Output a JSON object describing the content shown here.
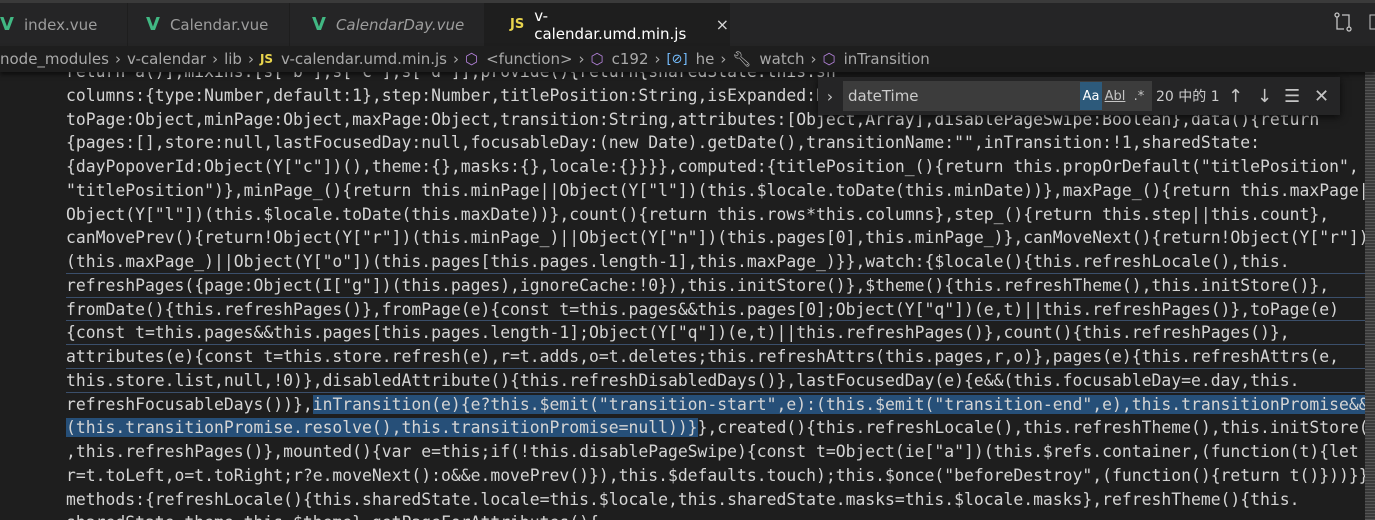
{
  "tabs": [
    {
      "label": "index.vue",
      "icon": "vue-icon"
    },
    {
      "label": "Calendar.vue",
      "icon": "vue-icon"
    },
    {
      "label": "CalendarDay.vue",
      "icon": "vue-icon"
    },
    {
      "label": "v-calendar.umd.min.js",
      "icon": "js-icon"
    }
  ],
  "tab_icon_text": {
    "vue": "V",
    "js": "JS",
    "close": "×"
  },
  "breadcrumb": [
    "node_modules",
    "v-calendar",
    "lib",
    "v-calendar.umd.min.js",
    "<function>",
    "c192",
    "he",
    "watch",
    "inTransition"
  ],
  "find": {
    "value": "dateTime",
    "match_case": "Aa",
    "whole_word": "Abl",
    "regex": ".*",
    "count": "20 中的 1",
    "expand": "›"
  },
  "code_lines": [
    {
      "text": "return a()],mixins:[s[\"b\"],s[\"c\"],s[\"d\"]],provide(){return{sharedState:this.sh"
    },
    {
      "text": "columns:{type:Number,default:1},step:Number,titlePosition:String,isExpanded:Bo"
    },
    {
      "text": "toPage:Object,minPage:Object,maxPage:Object,transition:String,attributes:[Object,Array],disablePageSwipe:Boolean},data(){return"
    },
    {
      "text": "{pages:[],store:null,lastFocusedDay:null,focusableDay:(new Date).getDate(),transitionName:\"\",inTransition:!1,sharedState:"
    },
    {
      "text": "{dayPopoverId:Object(Y[\"c\"])(),theme:{},masks:{},locale:{}}}},computed:{titlePosition_(){return this.propOrDefault(\"titlePosition\","
    },
    {
      "text": "\"titlePosition\")},minPage_(){return this.minPage||Object(Y[\"l\"])(this.$locale.toDate(this.minDate))},maxPage_(){return this.maxPage||"
    },
    {
      "text": "Object(Y[\"l\"])(this.$locale.toDate(this.maxDate))},count(){return this.rows*this.columns},step_(){return this.step||this.count},"
    },
    {
      "text": "canMovePrev(){return!Object(Y[\"r\"])(this.minPage_)||Object(Y[\"n\"])(this.pages[0],this.minPage_)},canMoveNext(){return!Object(Y[\"r\"])"
    },
    {
      "text": "(this.maxPage_)||Object(Y[\"o\"])(this.pages[this.pages.length-1],this.maxPage_)}},watch:{$locale(){this.refreshLocale(),this."
    },
    {
      "text": "refreshPages({page:Object(I[\"g\"])(this.pages),ignoreCache:!0}),this.initStore()},$theme(){this.refreshTheme(),this.initStore()},"
    },
    {
      "text": "fromDate(){this.refreshPages()},fromPage(e){const t=this.pages&&this.pages[0];Object(Y[\"q\"])(e,t)||this.refreshPages()},toPage(e)"
    },
    {
      "text": "{const t=this.pages&&this.pages[this.pages.length-1];Object(Y[\"q\"])(e,t)||this.refreshPages()},count(){this.refreshPages()},"
    },
    {
      "text": "attributes(e){const t=this.store.refresh(e),r=t.adds,o=t.deletes;this.refreshAttrs(this.pages,r,o)},pages(e){this.refreshAttrs(e,"
    },
    {
      "text": "this.store.list,null,!0)},disabledAttribute(){this.refreshDisabledDays()},lastFocusedDay(e){e&&(this.focusableDay=e.day,this."
    },
    {
      "pre": "refreshFocusableDays())},",
      "sel": "inTransition(e){e?this.$emit(\"transition-start\",e):(this.$emit(\"transition-end\",e),this.transitionPromise&&",
      "post": ""
    },
    {
      "pre": "",
      "sel": "(this.transitionPromise.resolve(),this.transitionPromise=null))}",
      "post": "},created(){this.refreshLocale(),this.refreshTheme(),this.initStore()"
    },
    {
      "text": ",this.refreshPages()},mounted(){var e=this;if(!this.disablePageSwipe){const t=Object(ie[\"a\"])(this.$refs.container,(function(t){let"
    },
    {
      "text": "r=t.toLeft,o=t.toRight;r?e.moveNext():o&&e.movePrev()}),this.$defaults.touch);this.$once(\"beforeDestroy\",(function(){return t()}))}},"
    },
    {
      "text": "methods:{refreshLocale(){this.sharedState.locale=this.$locale,this.sharedState.masks=this.$locale.masks},refreshTheme(){this."
    },
    {
      "text": "sharedState.theme=this.$theme},getPageForAttributes(){"
    }
  ]
}
